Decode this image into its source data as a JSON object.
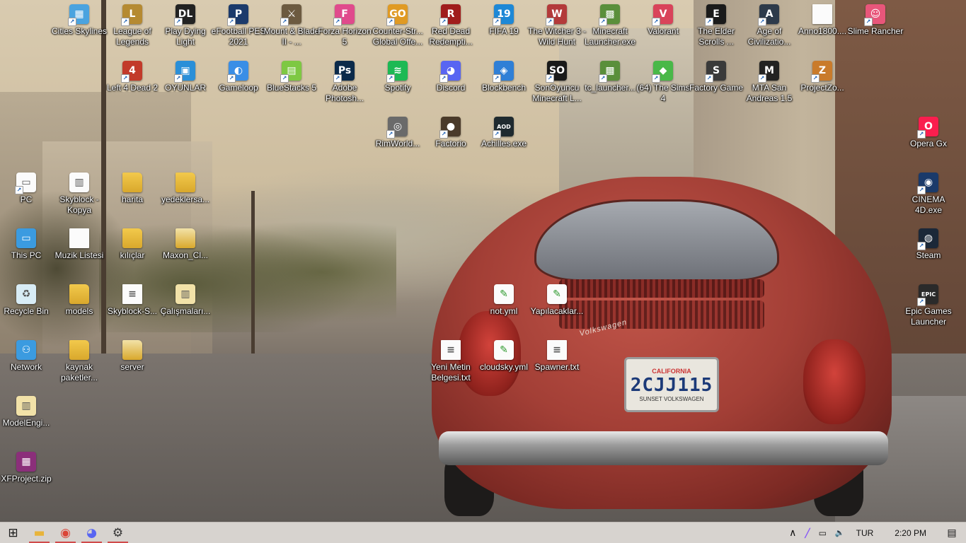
{
  "desktop": {
    "icons": [
      {
        "label": "Cities Skylines",
        "glyph": "▦",
        "color": "#4aa3df",
        "icon": "cities-skylines-icon"
      },
      {
        "label": "League of Legends",
        "glyph": "L",
        "color": "#b58a32",
        "icon": "league-of-legends-icon"
      },
      {
        "label": "Play Dying Light",
        "glyph": "DL",
        "color": "#222222",
        "icon": "dying-light-icon"
      },
      {
        "label": "eFootball PES 2021",
        "glyph": "P",
        "color": "#1b3a6b",
        "icon": "pes-icon"
      },
      {
        "label": "Mount & Blade II - ...",
        "glyph": "⚔",
        "color": "#6c5a40",
        "icon": "mount-blade-icon"
      },
      {
        "label": "Forza Horizon 5",
        "glyph": "F",
        "color": "#e04a8c",
        "icon": "forza-icon"
      },
      {
        "label": "Counter-Str... Global Offe...",
        "glyph": "GO",
        "color": "#e09a23",
        "icon": "csgo-icon"
      },
      {
        "label": "Red Dead Redempti...",
        "glyph": "R",
        "color": "#a01c1c",
        "icon": "red-dead-icon"
      },
      {
        "label": "FIFA 19",
        "glyph": "19",
        "color": "#1e88d6",
        "icon": "fifa-icon"
      },
      {
        "label": "The Witcher 3 - Wild Hunt",
        "glyph": "W",
        "color": "#b33a3a",
        "icon": "witcher-icon"
      },
      {
        "label": "Minecraft Launcher.exe",
        "glyph": "▩",
        "color": "#5a8f3b",
        "icon": "minecraft-icon"
      },
      {
        "label": "Valorant",
        "glyph": "V",
        "color": "#d9435a",
        "icon": "valorant-icon"
      },
      {
        "label": "The Elder Scrolls ...",
        "glyph": "E",
        "color": "#1a1a1a",
        "icon": "elder-scrolls-icon"
      },
      {
        "label": "Age of Civilizatio...",
        "glyph": "A",
        "color": "#2d3a4a",
        "icon": "age-of-civilization-icon"
      },
      {
        "label": "Anno1800....",
        "glyph": "",
        "color": "#fbfbfb",
        "icon": "file-icon"
      },
      {
        "label": "Slime Rancher",
        "glyph": "☺",
        "color": "#e8567a",
        "icon": "slime-rancher-icon"
      },
      {
        "label": "Left 4 Dead 2",
        "glyph": "4",
        "color": "#c23a2a",
        "icon": "left4dead-icon"
      },
      {
        "label": "OYUNLAR",
        "glyph": "▣",
        "color": "#2a8fd8",
        "icon": "folder-3d-icon"
      },
      {
        "label": "Gameloop",
        "glyph": "◐",
        "color": "#3a8ee6",
        "icon": "gameloop-icon"
      },
      {
        "label": "BlueStacks 5",
        "glyph": "▤",
        "color": "#7ec843",
        "icon": "bluestacks-icon"
      },
      {
        "label": "Adobe Photosh...",
        "glyph": "Ps",
        "color": "#0b2a4a",
        "icon": "photoshop-icon"
      },
      {
        "label": "Spotify",
        "glyph": "≋",
        "color": "#1db954",
        "icon": "spotify-icon"
      },
      {
        "label": "Discord",
        "glyph": "◕",
        "color": "#5865f2",
        "icon": "discord-icon"
      },
      {
        "label": "Blockbench",
        "glyph": "◈",
        "color": "#2f7fd6",
        "icon": "blockbench-icon"
      },
      {
        "label": "SonOyuncu Minecraft L...",
        "glyph": "SO",
        "color": "#1a1a1a",
        "icon": "sonoyuncu-icon"
      },
      {
        "label": "tc_launcher...",
        "glyph": "▩",
        "color": "#5a8f3b",
        "icon": "tc-launcher-icon"
      },
      {
        "label": "(64) The Sims 4",
        "glyph": "◆",
        "color": "#49b848",
        "icon": "sims-icon"
      },
      {
        "label": "Factory Game",
        "glyph": "S",
        "color": "#3a3a3a",
        "icon": "satisfactory-icon"
      },
      {
        "label": "MTA San Andreas 1.5",
        "glyph": "M",
        "color": "#222222",
        "icon": "mta-icon"
      },
      {
        "label": "ProjectZo...",
        "glyph": "Z",
        "color": "#c97b2b",
        "icon": "project-zomboid-icon"
      },
      {
        "label": "RimWorld...",
        "glyph": "◎",
        "color": "#6a6a6a",
        "icon": "rimworld-icon"
      },
      {
        "label": "Factorio",
        "glyph": "●",
        "color": "#4a3a2a",
        "icon": "factorio-icon"
      },
      {
        "label": "Achilles.exe",
        "glyph": "AOD",
        "color": "#1f2a2f",
        "icon": "achilles-icon"
      },
      {
        "label": "Opera Gx",
        "glyph": "O",
        "color": "#fa1e4e",
        "icon": "opera-gx-icon"
      },
      {
        "label": "PC",
        "glyph": "▭",
        "color": "#fbfbfb",
        "icon": "pc-shortcut-icon"
      },
      {
        "label": "Skyblock - Kopya",
        "glyph": "▥",
        "color": "#fbfbfb",
        "icon": "folder-zip-icon"
      },
      {
        "label": "harita",
        "glyph": "",
        "color": "#f2c94c",
        "icon": "folder-icon"
      },
      {
        "label": "yedeklersa...",
        "glyph": "",
        "color": "#f2c94c",
        "icon": "folder-icon"
      },
      {
        "label": "CINEMA 4D.exe",
        "glyph": "◉",
        "color": "#1a3a6a",
        "icon": "cinema4d-icon"
      },
      {
        "label": "This PC",
        "glyph": "▭",
        "color": "#3b9be0",
        "icon": "this-pc-icon"
      },
      {
        "label": "Muzik Listesi",
        "glyph": "",
        "color": "#fbfbfb",
        "icon": "file-icon"
      },
      {
        "label": "kılıçlar",
        "glyph": "",
        "color": "#f2c94c",
        "icon": "folder-icon"
      },
      {
        "label": "Maxon_Cl...",
        "glyph": "",
        "color": "#f2e2a8",
        "icon": "folder-icon"
      },
      {
        "label": "Steam",
        "glyph": "◍",
        "color": "#1b2838",
        "icon": "steam-icon"
      },
      {
        "label": "Recycle Bin",
        "glyph": "♻",
        "color": "#d8ecf5",
        "icon": "recycle-bin-icon"
      },
      {
        "label": "models",
        "glyph": "",
        "color": "#f2c94c",
        "icon": "folder-icon"
      },
      {
        "label": "Skyblock-S...",
        "glyph": "≡",
        "color": "#fbfbfb",
        "icon": "text-file-icon"
      },
      {
        "label": "Çalışmaları...",
        "glyph": "▥",
        "color": "#f2e2a8",
        "icon": "folder-zip-icon"
      },
      {
        "label": "not.yml",
        "glyph": "✎",
        "color": "#fbfbfb",
        "icon": "yml-file-icon"
      },
      {
        "label": "Yapılacaklar...",
        "glyph": "✎",
        "color": "#fbfbfb",
        "icon": "yml-file-icon"
      },
      {
        "label": "Epic Games Launcher",
        "glyph": "EPIC",
        "color": "#2a2a2a",
        "icon": "epic-games-icon"
      },
      {
        "label": "Network",
        "glyph": "⚇",
        "color": "#3b9be0",
        "icon": "network-icon"
      },
      {
        "label": "kaynak paketler...",
        "glyph": "",
        "color": "#f2c94c",
        "icon": "folder-icon"
      },
      {
        "label": "server",
        "glyph": "",
        "color": "#f2e2a8",
        "icon": "folder-icon"
      },
      {
        "label": "Yeni Metin Belgesi.txt",
        "glyph": "≡",
        "color": "#fbfbfb",
        "icon": "text-file-icon"
      },
      {
        "label": "cloudsky.yml",
        "glyph": "✎",
        "color": "#fbfbfb",
        "icon": "yml-file-icon"
      },
      {
        "label": "Spawner.txt",
        "glyph": "≡",
        "color": "#fbfbfb",
        "icon": "text-file-icon"
      },
      {
        "label": "ModelEngi...",
        "glyph": "▥",
        "color": "#f2e2a8",
        "icon": "folder-zip-icon"
      },
      {
        "label": "XFProject.zip",
        "glyph": "▦",
        "color": "#8b2f7a",
        "icon": "winrar-archive-icon"
      }
    ]
  },
  "wallpaper": {
    "plate_top": "CALIFORNIA",
    "plate_number": "2CJJ115",
    "plate_bottom": "SUNSET VOLKSWAGEN",
    "car_badge": "Volkswagen"
  },
  "taskbar": {
    "pinned": [
      {
        "name": "start-button",
        "glyph": "⊞",
        "color": "#1a1a1a",
        "icon": "windows-icon"
      },
      {
        "name": "taskbar-file-explorer",
        "glyph": "▬",
        "color": "#e8b43a",
        "icon": "folder-icon"
      },
      {
        "name": "taskbar-chrome",
        "glyph": "◉",
        "color": "#db4437",
        "icon": "chrome-icon"
      },
      {
        "name": "taskbar-discord",
        "glyph": "◕",
        "color": "#5865f2",
        "icon": "discord-icon"
      },
      {
        "name": "taskbar-settings",
        "glyph": "⚙",
        "color": "#333333",
        "icon": "gear-icon"
      }
    ],
    "tray": {
      "chevron_glyph": "∧",
      "pen_glyph": "╱",
      "network_glyph": "▭",
      "volume_glyph": "🔈",
      "language": "TUR",
      "time": "2:20 PM",
      "notification_glyph": "▤"
    }
  }
}
